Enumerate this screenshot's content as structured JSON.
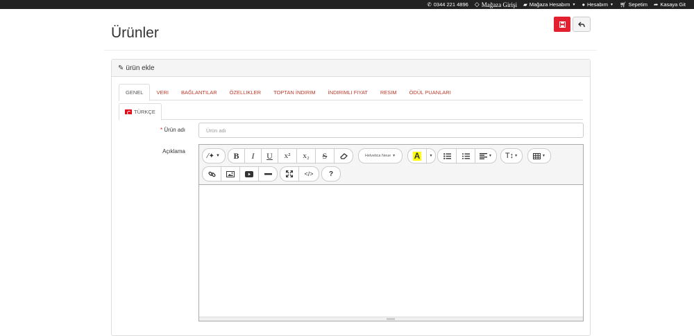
{
  "topbar": {
    "phone": "0344 221 4896",
    "store_login": "Mağaza Girişi",
    "store_account": "Mağaza Hesabım",
    "my_account": "Hesabım",
    "cart": "Sepetim",
    "checkout": "Kasaya Git"
  },
  "page": {
    "title": "Ürünler"
  },
  "panel": {
    "heading": "ürün ekle",
    "tabs": [
      "Genel",
      "Veri",
      "Bağlantılar",
      "Özellikler",
      "Toptan İndirim",
      "İndirimli Fiyat",
      "Resim",
      "Ödül Puanları"
    ],
    "active_tab": "Genel",
    "language_tab": "TÜRKÇE"
  },
  "form": {
    "name_required": "*",
    "name_label": "Ürün adı",
    "name_placeholder": "Ürün adı",
    "desc_label": "Açıklama"
  },
  "editor": {
    "font_name": "Helvetica Neue",
    "highlight_letter": "A",
    "highlight_color": "#ffff00",
    "buttons": {
      "bold": "B",
      "italic": "I",
      "underline": "U",
      "superscript": "x²",
      "subscript": "x₂",
      "strike": "S",
      "help": "?",
      "code": "</>",
      "line_height": "T↕"
    }
  },
  "colors": {
    "accent": "#e3202f",
    "topbar": "#222222",
    "link": "#c0392b"
  }
}
